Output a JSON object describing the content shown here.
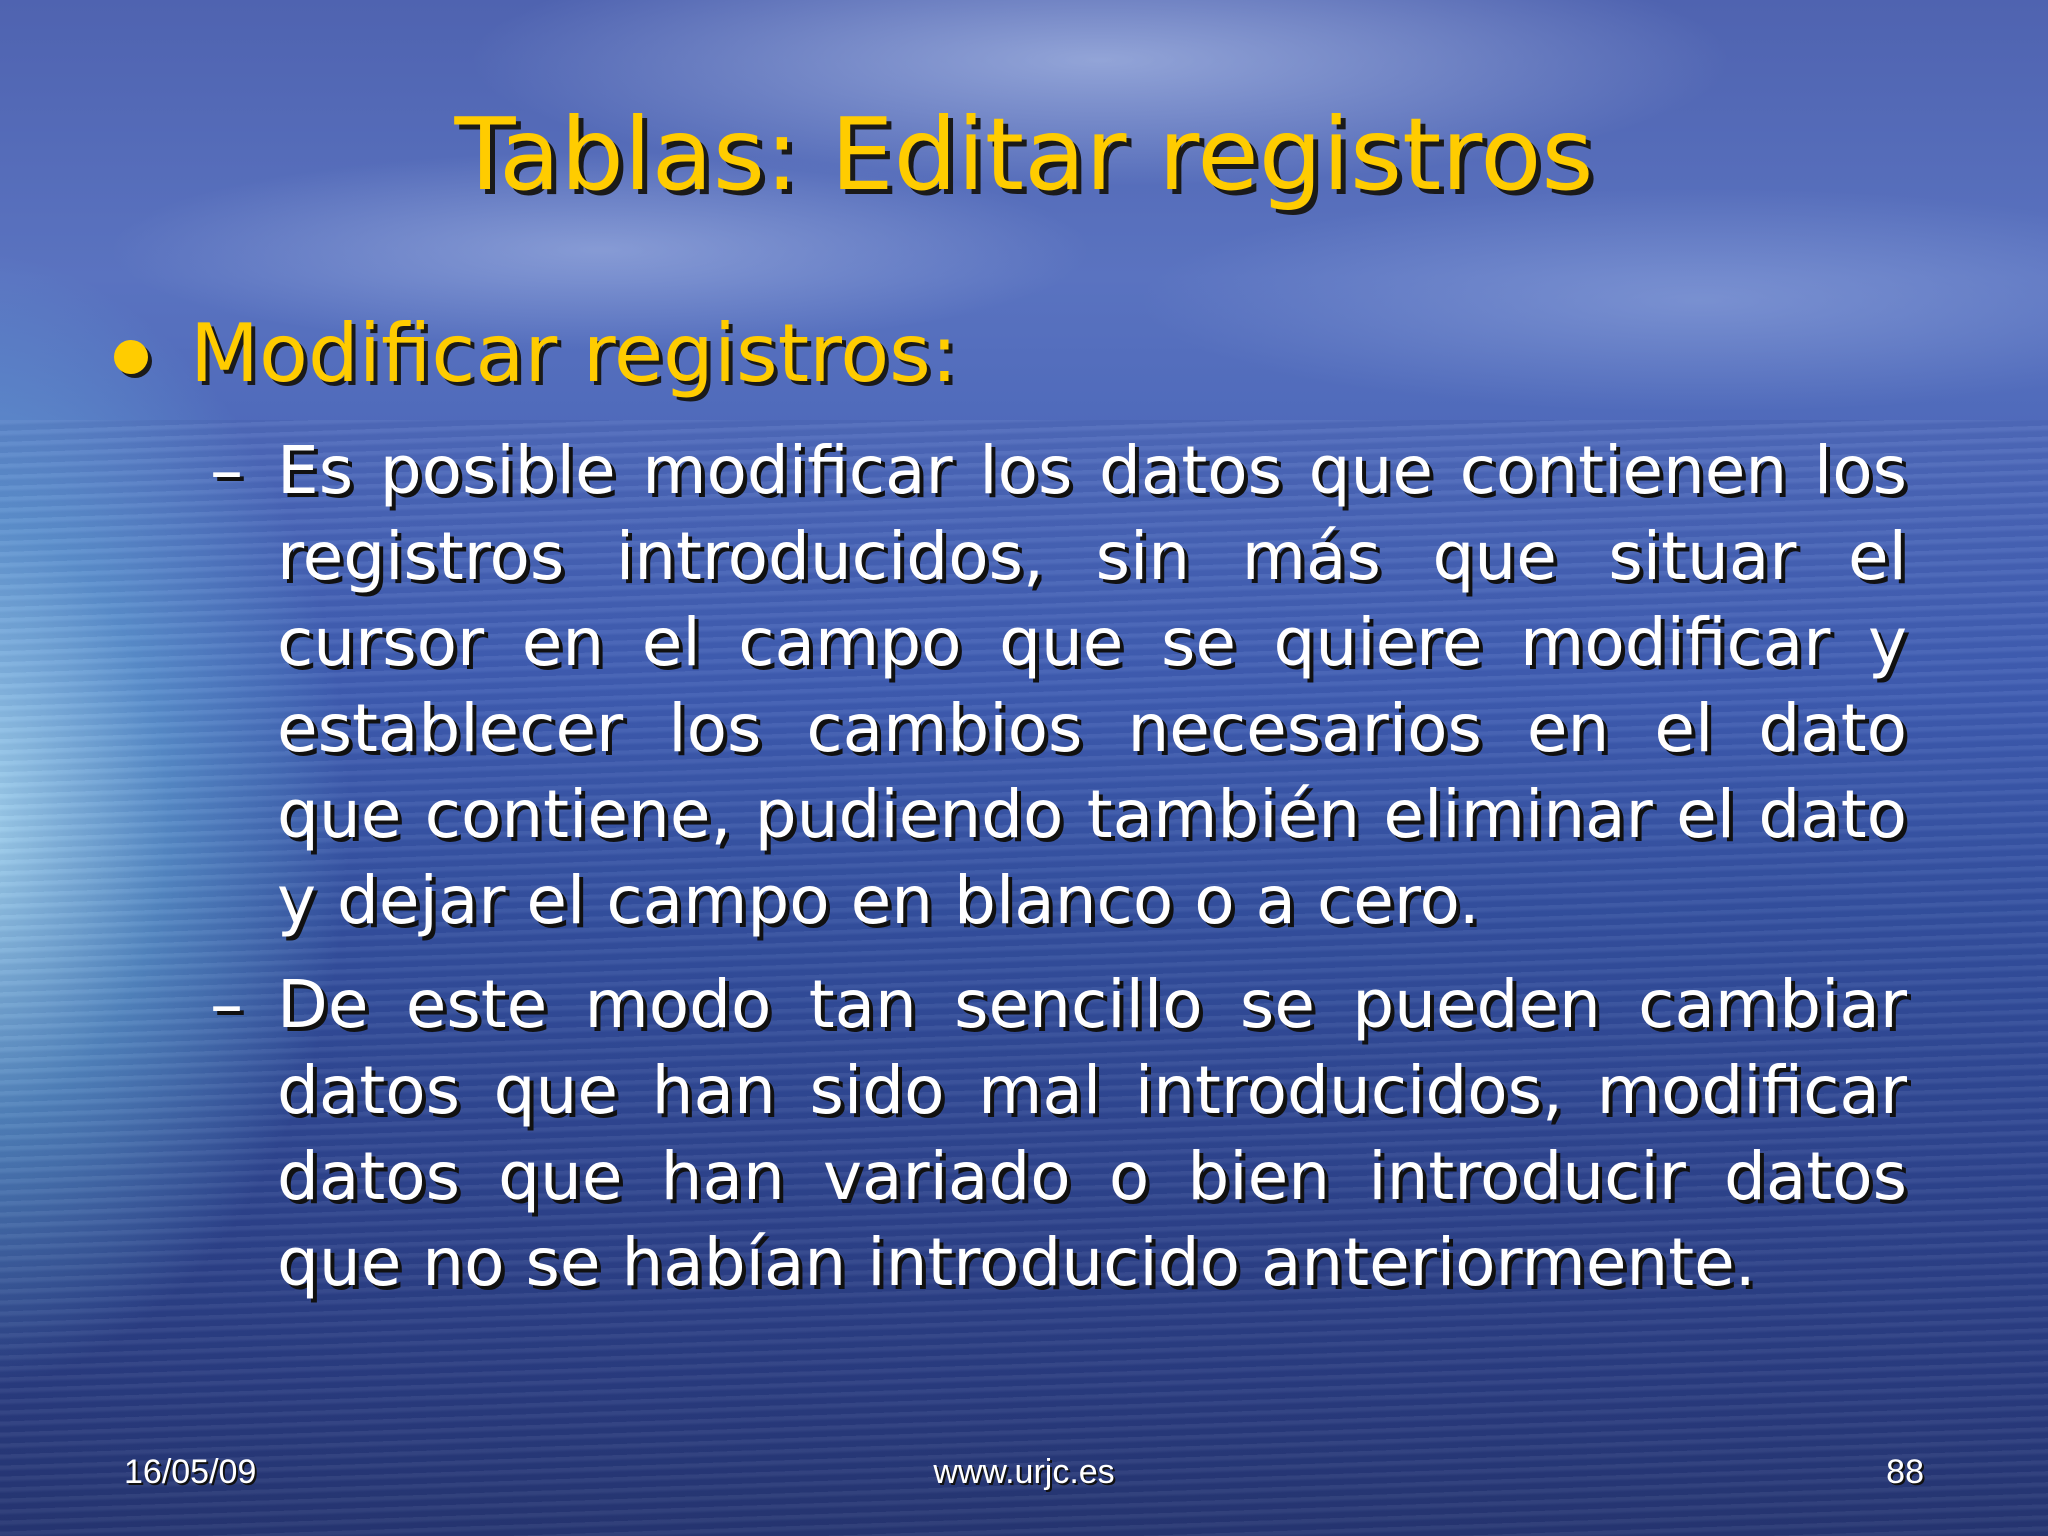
{
  "slide": {
    "title": "Tablas: Editar registros",
    "bullet": {
      "label": "Modificar registros:",
      "sub_items": [
        {
          "dash": "–",
          "text": "Es posible modificar los datos que contienen los registros introducidos, sin más que situar el cursor en el campo que se quiere modificar y establecer los cambios necesarios en el dato que contiene, pudiendo también eliminar el dato y dejar el campo en blanco o a cero."
        },
        {
          "dash": "–",
          "text": "De este modo tan sencillo se pueden cambiar datos que han sido mal introducidos, modificar datos que han variado o bien introducir datos que no se habían introducido anteriormente."
        }
      ]
    },
    "colors": {
      "title": "#ffcc00",
      "body": "#ffffff",
      "background": "#3f5db2"
    }
  },
  "footer": {
    "date": "16/05/09",
    "url": "www.urjc.es",
    "page_number": "88"
  }
}
